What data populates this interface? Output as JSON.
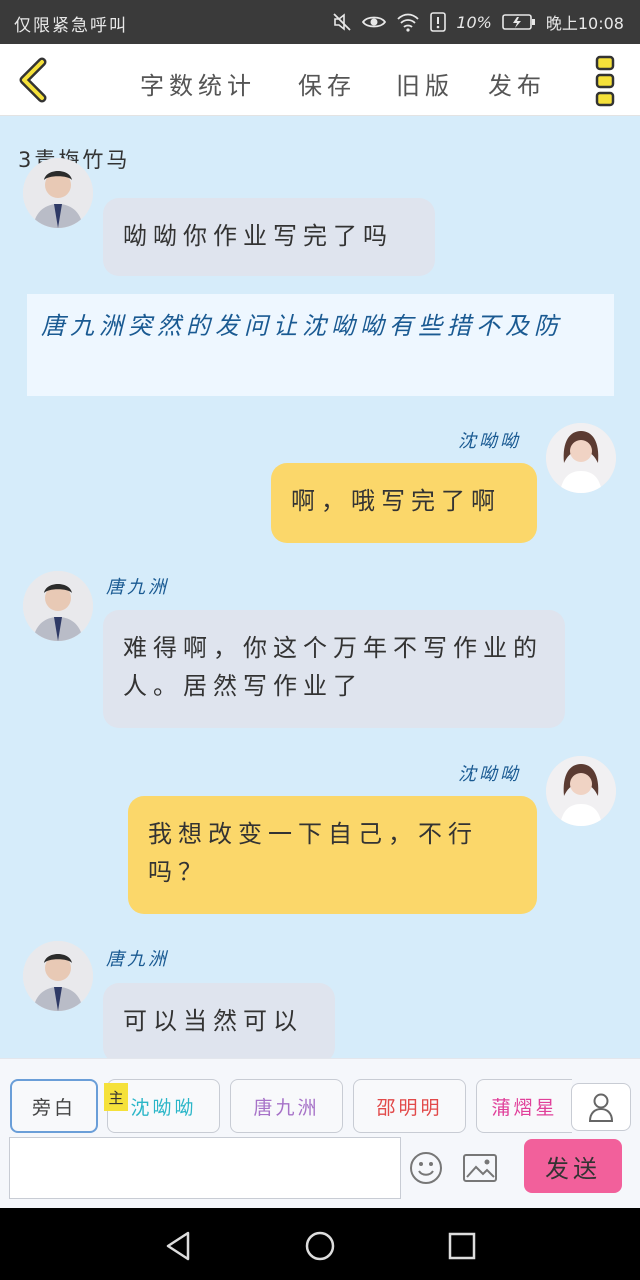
{
  "status_bar": {
    "left_text": "仅限紧急呼叫",
    "battery": "10%",
    "time": "晚上10:08",
    "icons": [
      "mute-icon",
      "eye-icon",
      "wifi-icon",
      "alert-icon",
      "battery-icon"
    ]
  },
  "toolbar": {
    "items": [
      "字数统计",
      "保存",
      "旧版",
      "发布"
    ],
    "icons": [
      "back-chevron-icon",
      "more-icon"
    ]
  },
  "story": {
    "title": "3青梅竹马"
  },
  "messages": [
    {
      "speaker": "",
      "text": "呦呦你作业写完了吗"
    },
    {
      "narration": "唐九洲突然的发问让沈呦呦有些措不及防"
    },
    {
      "speaker": "沈呦呦",
      "text": "啊，哦写完了啊"
    },
    {
      "speaker": "唐九洲",
      "text": "难得啊，你这个万年不写作业的人。居然写作业了"
    },
    {
      "speaker": "沈呦呦",
      "text": "我想改变一下自己，不行吗？"
    },
    {
      "speaker": "唐九洲",
      "text": "可以当然可以"
    }
  ],
  "character_bar": {
    "narration_tab": "旁白",
    "main_badge": "主",
    "characters": [
      "沈呦呦",
      "唐九洲",
      "邵明明",
      "蒲熠星"
    ],
    "colors": {
      "沈呦呦": "#2bb6c8",
      "唐九洲": "#a773c8",
      "邵明明": "#e24a4a",
      "蒲熠星": "#e0409a"
    }
  },
  "input": {
    "placeholder": "",
    "send_label": "发送"
  },
  "colors": {
    "accent_pink": "#f2609b",
    "bubble_yellow": "#fbd76a",
    "bubble_gray": "#dfe4ee",
    "background": "#d6ecfa",
    "name_blue": "#1a5a92"
  }
}
